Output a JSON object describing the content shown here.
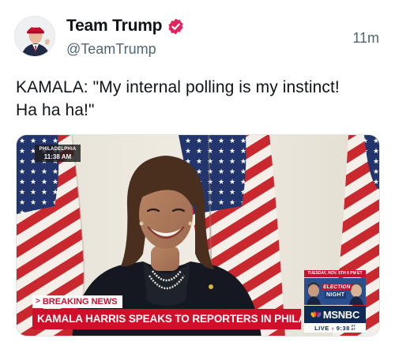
{
  "account": {
    "display_name": "Team Trump",
    "handle": "@TeamTrump",
    "time_ago": "11m",
    "verified": true
  },
  "tweet": {
    "text_line1": "KAMALA: \"My internal polling is my instinct!",
    "text_line2": "Ha ha ha!\""
  },
  "video": {
    "location": "PHILADELPHIA",
    "local_time": "11:38 AM",
    "breaking_label": "BREAKING NEWS",
    "headline": "KAMALA HARRIS SPEAKS TO REPORTERS IN PHILADELPHIA",
    "promo_date": "TUESDAY, NOV. 5TH 6 PM ET",
    "promo_title_1": "ELECTION",
    "promo_title_2": "NIGHT",
    "network": "MSNBC",
    "live_label": "LIVE",
    "live_time": "9:38",
    "live_tz": "PT",
    "live_tz2": "ET"
  },
  "colors": {
    "verified_badge": "#e0245e",
    "breaking_red": "#d0102b",
    "network_blue": "#0f2a55"
  }
}
